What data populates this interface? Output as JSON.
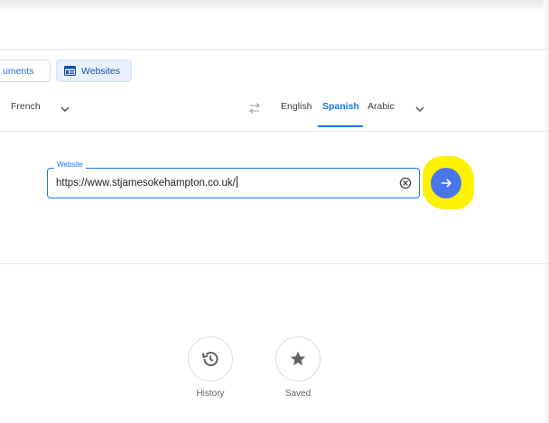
{
  "tabs": {
    "documents_label": "uments",
    "websites_label": "Websites"
  },
  "source_lang": {
    "selected": "French"
  },
  "target_lang": {
    "options": [
      "English",
      "Spanish",
      "Arabic"
    ],
    "selected": "Spanish"
  },
  "website_field": {
    "label": "Website",
    "value": "https://www.stjamesokehampton.co.uk/"
  },
  "actions": {
    "history_label": "History",
    "saved_label": "Saved"
  },
  "colors": {
    "accent": "#1a73e8",
    "go_button": "#4876ea",
    "highlight": "#fff200"
  },
  "icons": {
    "websites_tab": "website-icon",
    "swap": "swap-languages-icon",
    "dropdown": "chevron-down-icon",
    "clear": "clear-icon",
    "go": "arrow-right-icon",
    "history": "history-icon",
    "saved": "star-icon"
  }
}
